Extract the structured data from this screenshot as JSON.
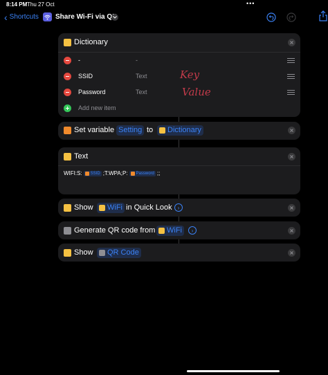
{
  "status_bar": {
    "time": "8:14 PM",
    "date": "Thu 27 Oct",
    "dots": "•••"
  },
  "nav": {
    "back_label": "Shortcuts",
    "title": "Share Wi-Fi via QR"
  },
  "dictionary": {
    "title": "Dictionary",
    "rows": [
      {
        "key": "-",
        "value": "-"
      },
      {
        "key": "SSID",
        "value": "Text"
      },
      {
        "key": "Password",
        "value": "Text"
      }
    ],
    "add_label": "Add new item"
  },
  "annotations": {
    "key": "Key",
    "value": "Value"
  },
  "set_variable": {
    "label": "Set variable",
    "variable": "Setting",
    "to": "to",
    "target": "Dictionary"
  },
  "text_action": {
    "title": "Text",
    "segments": {
      "prefix": "WIFI:S:",
      "ssid": "SSID",
      "middle": ";T:WPA;P:",
      "password": "Password",
      "suffix": ";;"
    }
  },
  "show_quicklook": {
    "label": "Show",
    "variable": "WiFi",
    "suffix": "in Quick Look"
  },
  "generate_qr": {
    "label": "Generate QR code from",
    "variable": "WiFi"
  },
  "show_qr": {
    "label": "Show",
    "variable": "QR Code"
  },
  "colors": {
    "accent": "#3b82f6",
    "card": "#1c1c1e",
    "background": "#000000",
    "remove": "#e5483f",
    "add": "#34c759",
    "dictionary_icon": "#f5c142",
    "variable_icon": "#f08a2c",
    "annotation": "#c23b4a"
  }
}
